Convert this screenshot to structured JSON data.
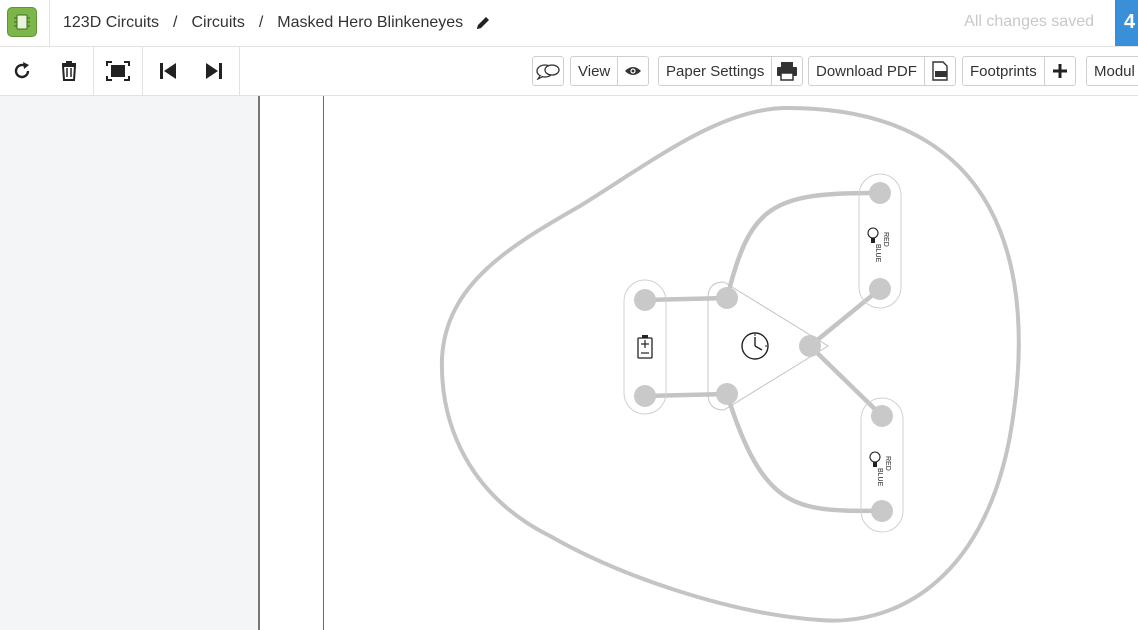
{
  "header": {
    "breadcrumb": [
      "123D Circuits",
      "Circuits",
      "Masked Hero Blinkeneyes"
    ],
    "breadcrumb_separator": "/",
    "save_status": "All changes saved",
    "corner_button_glyph": "4"
  },
  "toolbar": {
    "icons": [
      "rotate-icon",
      "trash-icon",
      "fit-screen-icon",
      "step-back-icon",
      "step-forward-icon"
    ],
    "comments_icon": "speech-bubbles-icon",
    "view_label": "View",
    "paper_settings_label": "Paper Settings",
    "download_pdf_label": "Download PDF",
    "footprints_label": "Footprints",
    "modules_label": "Modul"
  },
  "board": {
    "components": [
      {
        "name": "battery",
        "label": "+\n-"
      },
      {
        "name": "timer",
        "label": "clock"
      },
      {
        "name": "led-top",
        "label": "RED BLUE"
      },
      {
        "name": "led-bottom",
        "label": "RED BLUE"
      }
    ],
    "led_text_line1": "RED",
    "led_text_line2": "BLUE",
    "colors": {
      "trace": "#c4c4c4",
      "outline": "#c4c4c4",
      "pad": "#c9c9c9",
      "margin_line": "#e0392b",
      "accent": "#3a8fd9",
      "logo": "#7ab648"
    }
  }
}
